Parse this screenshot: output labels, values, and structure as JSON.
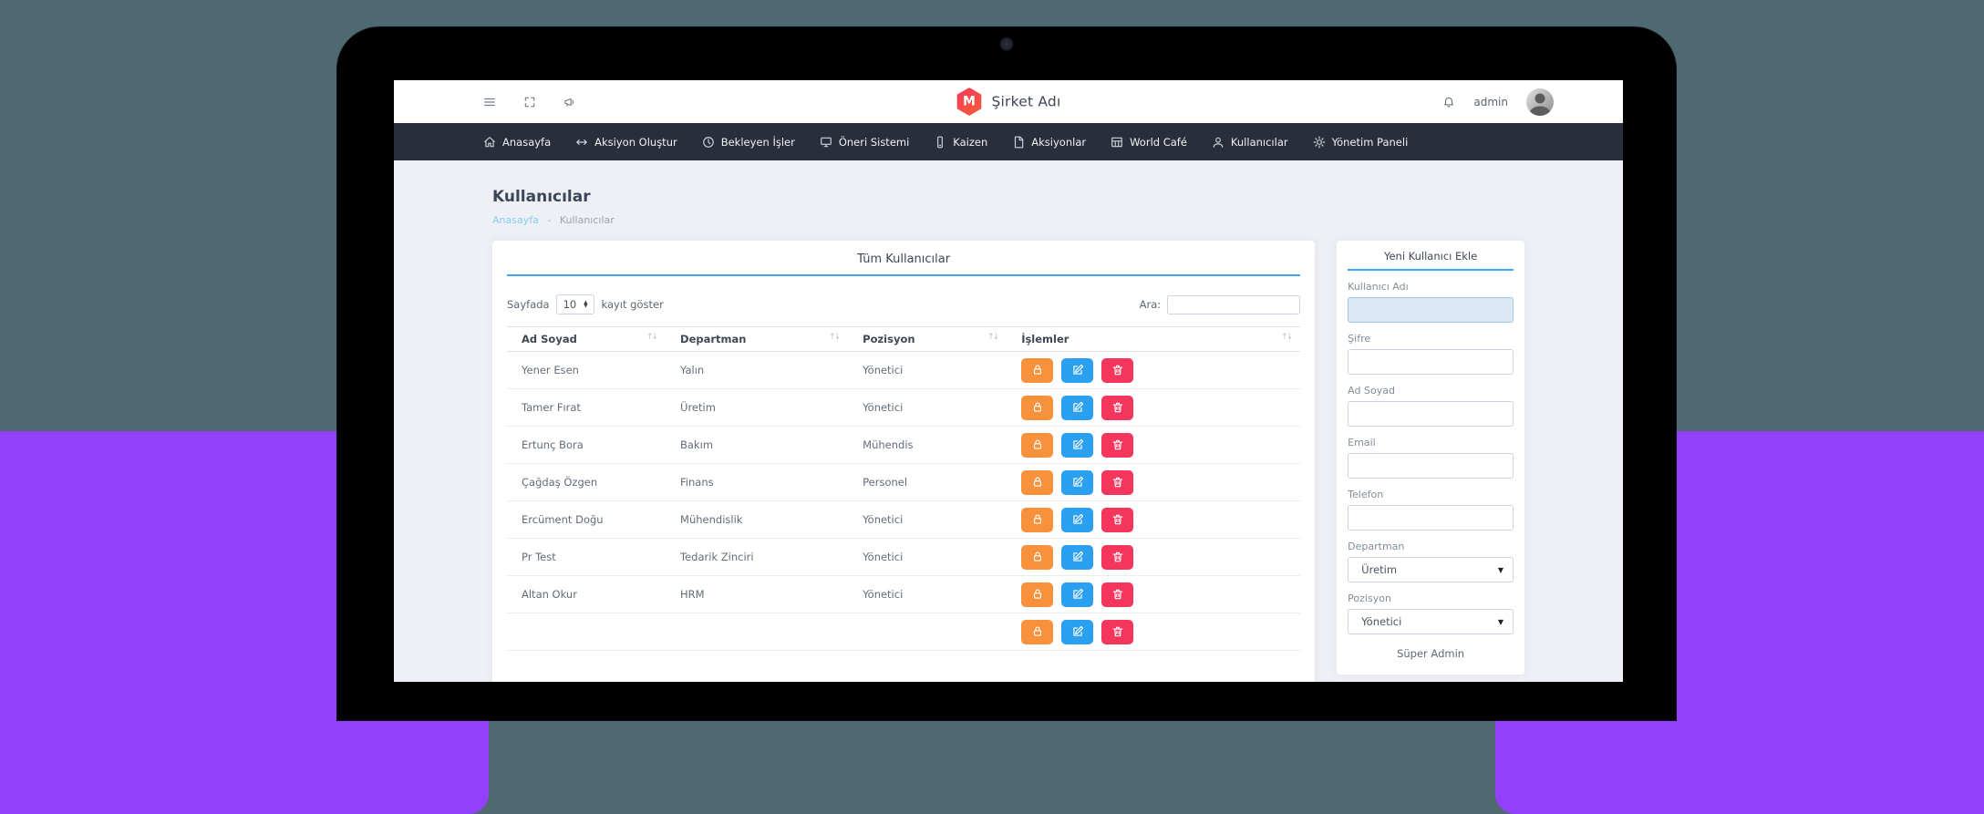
{
  "scene": {
    "background_color": "#4e6971",
    "shape_color": "#9340fb",
    "bezel_color": "#000000",
    "accent_blue": "#41a4ef"
  },
  "header": {
    "brand": "Şirket Adı",
    "brand_initial": "M",
    "left_icons": [
      "menu-icon",
      "fullscreen-icon",
      "megaphone-icon"
    ],
    "right": {
      "bell_icon": "bell-icon",
      "username": "admin",
      "avatar_icon": "user-photo"
    }
  },
  "nav": {
    "items": [
      {
        "icon": "home",
        "label": "Anasayfa"
      },
      {
        "icon": "arrows",
        "label": "Aksiyon Oluştur"
      },
      {
        "icon": "clock",
        "label": "Bekleyen İşler"
      },
      {
        "icon": "monitor",
        "label": "Öneri Sistemi"
      },
      {
        "icon": "phone",
        "label": "Kaizen"
      },
      {
        "icon": "file",
        "label": "Aksiyonlar"
      },
      {
        "icon": "table",
        "label": "World Café"
      },
      {
        "icon": "user",
        "label": "Kullanıcılar"
      },
      {
        "icon": "gear",
        "label": "Yönetim Paneli"
      }
    ]
  },
  "page": {
    "title": "Kullanıcılar",
    "breadcrumb": {
      "home": "Anasayfa",
      "sep": "-",
      "current": "Kullanıcılar"
    }
  },
  "users_card": {
    "title": "Tüm Kullanıcılar",
    "page_size": {
      "prefix": "Sayfada",
      "value": "10",
      "suffix": "kayıt göster"
    },
    "search_label": "Ara:",
    "search_value": "",
    "sort_glyph": "↑↓",
    "columns": [
      "Ad Soyad",
      "Departman",
      "Pozisyon",
      "İşlemler"
    ],
    "actions": [
      {
        "icon": "lock",
        "name": "lock-user-button",
        "color": "#f8913c"
      },
      {
        "icon": "edit",
        "name": "edit-user-button",
        "color": "#2b9ff0"
      },
      {
        "icon": "trash",
        "name": "delete-user-button",
        "color": "#f5365c"
      }
    ],
    "rows": [
      {
        "name": "Yener Esen",
        "department": "Yalın",
        "position": "Yönetici"
      },
      {
        "name": "Tamer Fırat",
        "department": "Üretim",
        "position": "Yönetici"
      },
      {
        "name": "Ertunç Bora",
        "department": "Bakım",
        "position": "Mühendis"
      },
      {
        "name": "Çağdaş Özgen",
        "department": "Finans",
        "position": "Personel"
      },
      {
        "name": "Ercüment Doğu",
        "department": "Mühendislik",
        "position": "Yönetici"
      },
      {
        "name": "Pr Test",
        "department": "Tedarik Zinciri",
        "position": "Yönetici"
      },
      {
        "name": "Altan Okur",
        "department": "HRM",
        "position": "Yönetici"
      },
      {
        "name": "",
        "department": "",
        "position": ""
      }
    ]
  },
  "form_card": {
    "title": "Yeni Kullanıcı Ekle",
    "fields": [
      {
        "label": "Kullanıcı Adı",
        "type": "text",
        "value": "",
        "highlighted": true
      },
      {
        "label": "Şifre",
        "type": "text",
        "value": ""
      },
      {
        "label": "Ad Soyad",
        "type": "text",
        "value": ""
      },
      {
        "label": "Email",
        "type": "text",
        "value": ""
      },
      {
        "label": "Telefon",
        "type": "text",
        "value": ""
      },
      {
        "label": "Departman",
        "type": "select",
        "value": "Üretim"
      },
      {
        "label": "Pozisyon",
        "type": "select",
        "value": "Yönetici"
      }
    ],
    "footer_label": "Süper Admin"
  }
}
